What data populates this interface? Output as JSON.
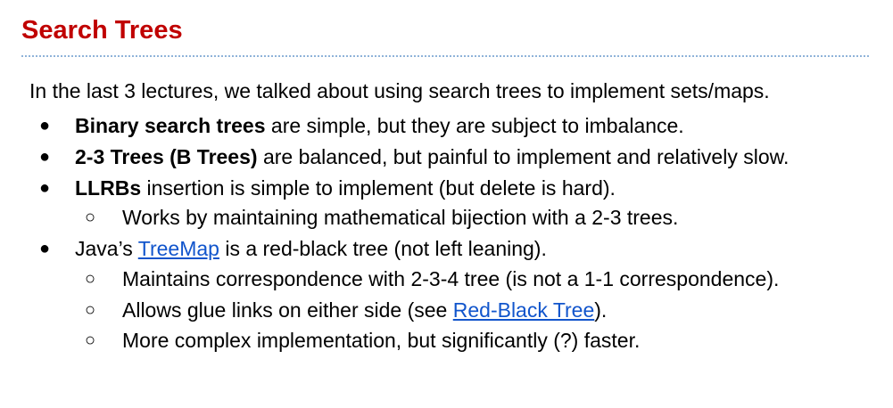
{
  "title": "Search Trees",
  "intro": "In the last 3 lectures, we talked about using search trees to implement sets/maps.",
  "bullets": {
    "b1": {
      "bold": "Binary search trees",
      "rest": " are simple, but they are subject to imbalance."
    },
    "b2": {
      "bold": "2-3 Trees (B Trees)",
      "rest": " are balanced, but painful to implement and relatively slow."
    },
    "b3": {
      "bold": "LLRBs",
      "rest": " insertion is simple to implement (but delete is hard)."
    },
    "b3_sub1": "Works by maintaining mathematical bijection with a 2-3 trees.",
    "b4": {
      "pre": "Java’s ",
      "link": "TreeMap",
      "post": " is a red-black tree (not left leaning)."
    },
    "b4_sub1": "Maintains correspondence with 2-3-4 tree (is not a 1-1 correspondence).",
    "b4_sub2": {
      "pre": "Allows glue links on either side (see ",
      "link": "Red-Black Tree",
      "post": ")."
    },
    "b4_sub3": "More complex implementation, but significantly (?) faster."
  },
  "markers": {
    "level1": "●",
    "level2": "○"
  },
  "colors": {
    "title": "#c00000",
    "link": "#1155cc",
    "rule": "#8fb3d9"
  }
}
